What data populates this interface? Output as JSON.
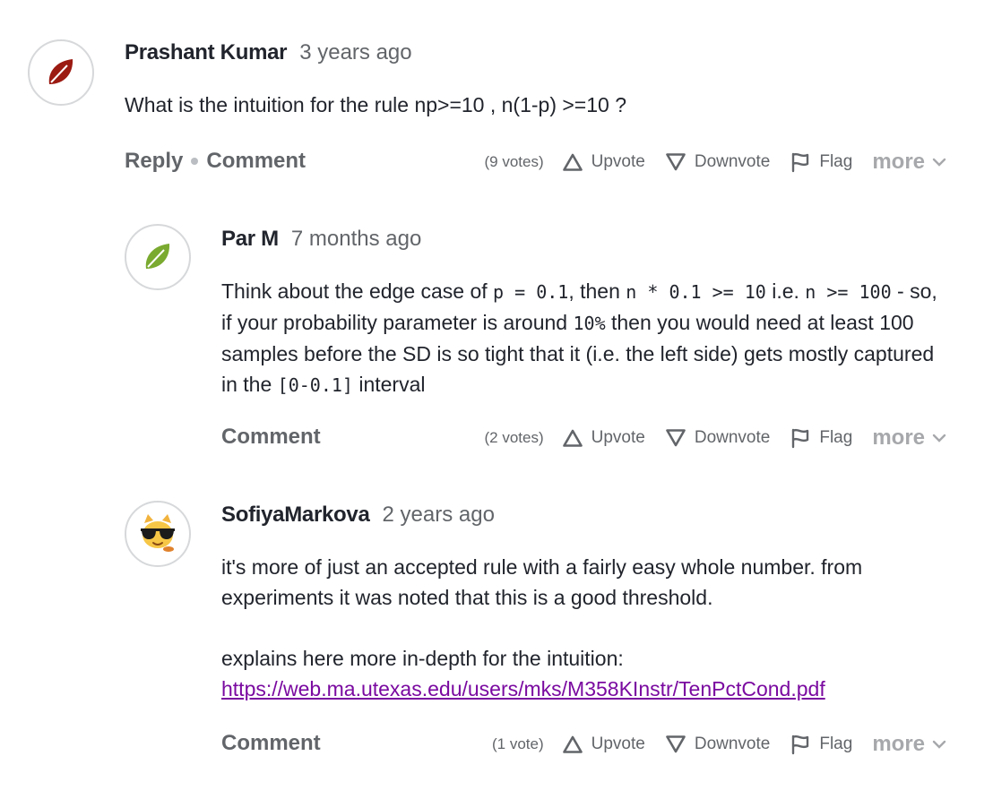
{
  "labels": {
    "reply": "Reply",
    "comment": "Comment",
    "upvote": "Upvote",
    "downvote": "Downvote",
    "flag": "Flag",
    "more": "more"
  },
  "comments": [
    {
      "author": "Prashant Kumar",
      "time": "3 years ago",
      "text": "What is the intuition for the rule np>=10 , n(1-p) >=10 ?",
      "votes": "(9 votes)",
      "avatar_icon": "dark-red-leaf-icon"
    },
    {
      "author": "Par M",
      "time": "7 months ago",
      "text_parts": [
        "Think about the edge case of ",
        "p = 0.1",
        ", then ",
        "n * 0.1 >= 10",
        " i.e. ",
        "n >= 100",
        " - so, if your probability parameter is around ",
        "10%",
        " then you would need at least 100 samples before the SD is so tight that it (i.e. the left side) gets mostly captured in the ",
        "[0-0.1]",
        " interval"
      ],
      "votes": "(2 votes)",
      "avatar_icon": "green-leaf-icon"
    },
    {
      "author": "SofiyaMarkova",
      "time": "2 years ago",
      "text_line1": "it's more of just an accepted rule with a fairly easy whole number. from experiments it was noted that this is a good threshold.",
      "text_line2": "explains here more in-depth for the intuition:",
      "link": "https://web.ma.utexas.edu/users/mks/M358KInstr/TenPctCond.pdf",
      "votes": "(1 vote)",
      "avatar_icon": "sunglasses-creature-icon"
    }
  ],
  "colors": {
    "text": "#21242c",
    "muted": "#626569",
    "more": "#a6a8ab",
    "link": "#7a0aa0",
    "leaf_red": "#9b1a12",
    "leaf_green": "#7aaa30"
  }
}
